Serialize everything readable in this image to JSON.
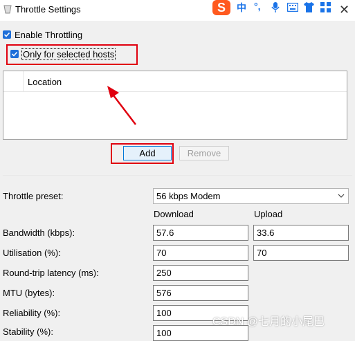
{
  "window": {
    "title": "Throttle Settings",
    "close_glyph": "✕"
  },
  "ime": {
    "logo": "S",
    "mode": "中",
    "punct": "°,",
    "items": [
      "mic-icon",
      "keyboard-icon",
      "shirt-icon",
      "grid-icon"
    ]
  },
  "options": {
    "enable_throttling": {
      "label": "Enable Throttling",
      "checked": true
    },
    "only_selected_hosts": {
      "label": "Only for selected hosts",
      "checked": true
    }
  },
  "hosts_table": {
    "columns": [
      "Location"
    ],
    "rows": []
  },
  "buttons": {
    "add": "Add",
    "remove": "Remove"
  },
  "settings": {
    "preset_label": "Throttle preset:",
    "preset_value": "56 kbps Modem",
    "download_header": "Download",
    "upload_header": "Upload",
    "rows": [
      {
        "label": "Bandwidth (kbps):",
        "download": "57.6",
        "upload": "33.6"
      },
      {
        "label": "Utilisation (%):",
        "download": "70",
        "upload": "70"
      },
      {
        "label": "Round-trip latency (ms):",
        "download": "250"
      },
      {
        "label": "MTU (bytes):",
        "download": "576"
      },
      {
        "label": "Reliability (%):",
        "download": "100"
      },
      {
        "label": "Stability (%):",
        "download": "100"
      }
    ]
  },
  "watermark": "CSDN @七月的小尾巴",
  "colors": {
    "highlight": "#e0000f",
    "checkbox": "#1e6fd9"
  }
}
